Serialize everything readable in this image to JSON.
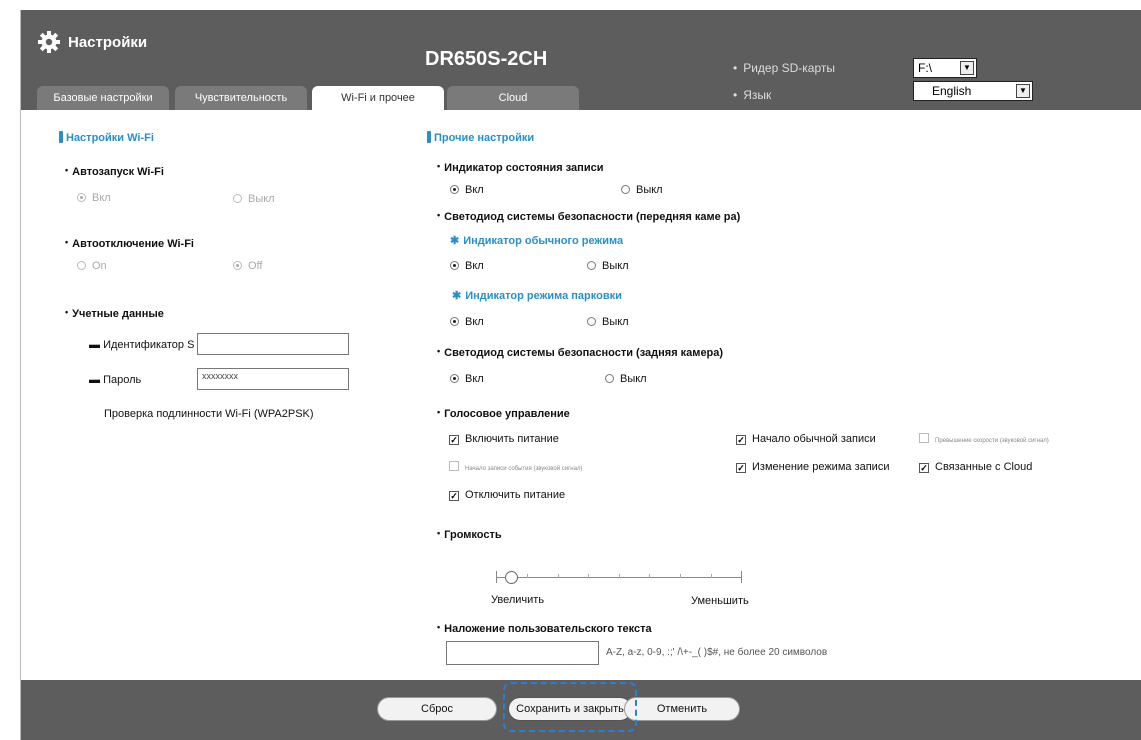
{
  "header": {
    "app_title": "Настройки",
    "model": "DR650S-2CH",
    "sd_label": "Ридер SD-карты",
    "sd_value": "F:\\",
    "lang_label": "Язык",
    "lang_value": "English",
    "bullet": "•"
  },
  "tabs": [
    {
      "label": "Базовые настройки",
      "active": false
    },
    {
      "label": "Чувствительность",
      "active": false
    },
    {
      "label": "Wi-Fi и прочее",
      "active": true
    },
    {
      "label": "Cloud",
      "active": false
    }
  ],
  "wifi": {
    "title": "Настройки Wi-Fi",
    "autostart_label": "Автозапуск Wi-Fi",
    "autostart_on": "Вкл",
    "autostart_off": "Выкл",
    "autooff_label": "Автоотключение Wi-Fi",
    "autooff_on": "On",
    "autooff_off": "Off",
    "credentials_label": "Учетные данные",
    "id_label": "Идентификатор S",
    "id_value": "",
    "password_label": "Пароль",
    "password_value": "xxxxxxxx",
    "auth_text": "Проверка подлинности Wi-Fi (WPA2PSK)"
  },
  "other": {
    "title": "Прочие настройки",
    "rec_indicator_label": "Индикатор состояния записи",
    "on": "Вкл",
    "off": "Выкл",
    "front_led_label": "Светодиод системы безопасности (передняя каме ра)",
    "normal_mode_label": "Индикатор обычного режима",
    "parking_mode_label": "Индикатор режима парковки",
    "rear_led_label": "Светодиод системы безопасности (задняя камера)",
    "voice_label": "Голосовое управление",
    "voice_items": [
      {
        "label": "Включить питание",
        "checked": true
      },
      {
        "label": "Начало обычной записи",
        "checked": true
      },
      {
        "label": "Превышение скорости (звуковой сигнал)",
        "checked": false
      },
      {
        "label": "Начало записи события (звуковой сигнал)",
        "checked": false
      },
      {
        "label": "Изменение режима записи",
        "checked": true
      },
      {
        "label": "Связанные с Cloud",
        "checked": true
      },
      {
        "label": "Отключить питание",
        "checked": true
      }
    ],
    "volume_label": "Громкость",
    "volume_increase": "Увеличить",
    "volume_decrease": "Уменьшить",
    "volume_level": 0.06,
    "overlay_label": "Наложение пользовательского текста",
    "overlay_value": "",
    "overlay_hint": "A-Z, a-z, 0-9, :;' /\\+-_( )$#, не более 20 символов",
    "asterisk": "✱"
  },
  "footer": {
    "reset": "Сброс",
    "save_close": "Сохранить и закрыть",
    "cancel": "Отменить"
  },
  "colors": {
    "header_bg": "#5d5d5d",
    "accent": "#2a8fc9",
    "focus_ring": "#2a7fd4"
  }
}
